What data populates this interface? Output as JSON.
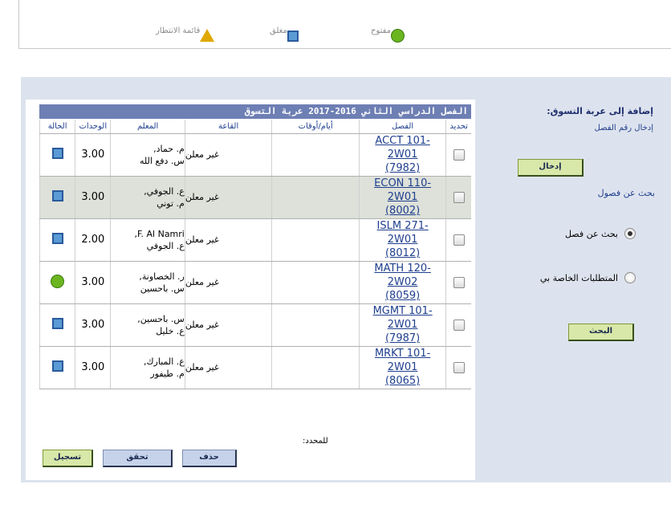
{
  "legend": {
    "open": {
      "label": "مفتوح",
      "icon": "green-circle-icon"
    },
    "closed": {
      "label": "مغلق",
      "icon": "blue-square-icon"
    },
    "waitlist": {
      "label": "قائمة الانتظار",
      "icon": "yellow-triangle-icon"
    }
  },
  "sidebar": {
    "title": "إضافة إلى عربة التسوق:",
    "enter_class_label": "إدخال رقم الفصل",
    "enter_button": "إدخال",
    "search_section": "بحث عن فصول",
    "radio_class_search": "بحث عن فصل",
    "radio_requirements": "المتطلبات الخاصة بي",
    "search_button": "البحث"
  },
  "cart": {
    "title": "الفصل الدراسي الثاني 2016-2017 عربة التسوق",
    "headers": {
      "select": "تحديد",
      "class": "الفصل",
      "days_times": "أيام/أوقات",
      "room": "القاعة",
      "instructor": "المعلم",
      "units": "الوحدات",
      "status": "الحالة"
    },
    "rows": [
      {
        "class_line1": "ACCT 101-",
        "class_line2": "2W01",
        "class_line3": "(7982)",
        "days_times": "",
        "room": "غير معلن",
        "instructor_line1": "م. حماد,",
        "instructor_line2": "س. دفع الله",
        "units": "3.00",
        "status": "closed"
      },
      {
        "class_line1": "ECON 110-",
        "class_line2": "2W01",
        "class_line3": "(8002)",
        "days_times": "",
        "room": "غير معلن",
        "instructor_line1": "ع. الجوفي,",
        "instructor_line2": "م. توني",
        "units": "3.00",
        "status": "closed"
      },
      {
        "class_line1": "ISLM 271-",
        "class_line2": "2W01",
        "class_line3": "(8012)",
        "days_times": "",
        "room": "غير معلن",
        "instructor_line1": "F. Al Namri,",
        "instructor_line2": "ع. الجوفي",
        "units": "2.00",
        "status": "closed"
      },
      {
        "class_line1": "MATH 120-",
        "class_line2": "2W02",
        "class_line3": "(8059)",
        "days_times": "",
        "room": "غير معلن",
        "instructor_line1": "ر. الخصاونة,",
        "instructor_line2": "س. باحسين",
        "units": "3.00",
        "status": "open"
      },
      {
        "class_line1": "MGMT 101-",
        "class_line2": "2W01",
        "class_line3": "(7987)",
        "days_times": "",
        "room": "غير معلن",
        "instructor_line1": "س. باحسين,",
        "instructor_line2": "ع. خليل",
        "units": "3.00",
        "status": "closed"
      },
      {
        "class_line1": "MRKT 101-",
        "class_line2": "2W01",
        "class_line3": "(8065)",
        "days_times": "",
        "room": "غير معلن",
        "instructor_line1": "ع. المبارك,",
        "instructor_line2": "م. طيفور",
        "units": "3.00",
        "status": "closed"
      }
    ],
    "selected_label": "للمحدد:",
    "buttons": {
      "delete": "حذف",
      "validate": "تحقق",
      "enroll": "تسجيل"
    }
  },
  "colors": {
    "open": "#6ab520",
    "closed": "#5b9bd5",
    "waitlist": "#e0a800",
    "header_bar": "#6e7fb4",
    "panel_bg": "#dde3ee"
  }
}
